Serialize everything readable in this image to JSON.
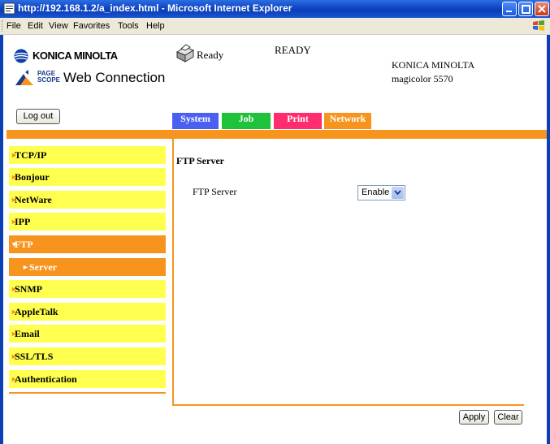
{
  "window": {
    "title": "http://192.168.1.2/a_index.html - Microsoft Internet Explorer"
  },
  "menu": [
    "File",
    "Edit",
    "View",
    "Favorites",
    "Tools",
    "Help"
  ],
  "header": {
    "brand": "KONICA MINOLTA",
    "pagescope_line1": "PAGE",
    "pagescope_line2": "SCOPE",
    "product": "Web Connection",
    "status_short": "Ready",
    "status_main": "READY",
    "device_brand": "KONICA MINOLTA",
    "device_model": "magicolor 5570"
  },
  "buttons": {
    "logout": "Log out",
    "apply": "Apply",
    "clear": "Clear"
  },
  "tabs": [
    {
      "label": "System",
      "color": "#4b5ff0"
    },
    {
      "label": "Job",
      "color": "#1fc23a"
    },
    {
      "label": "Print",
      "color": "#ff2d6e"
    },
    {
      "label": "Network",
      "color": "#f7941d"
    }
  ],
  "sidebar": {
    "items": [
      {
        "label": "TCP/IP"
      },
      {
        "label": "Bonjour"
      },
      {
        "label": "NetWare"
      },
      {
        "label": "IPP"
      },
      {
        "label": "FTP",
        "expanded": true
      },
      {
        "label": "Server",
        "sub": true,
        "active": true
      },
      {
        "label": "SNMP"
      },
      {
        "label": "AppleTalk"
      },
      {
        "label": "Email"
      },
      {
        "label": "SSL/TLS"
      },
      {
        "label": "Authentication"
      }
    ]
  },
  "main": {
    "heading": "FTP Server",
    "field_label": "FTP Server",
    "field_value": "Enable"
  },
  "colors": {
    "accent": "#f7941d",
    "sidebar_yellow": "#ffff4f",
    "title_blue": "#0b3fb6"
  }
}
